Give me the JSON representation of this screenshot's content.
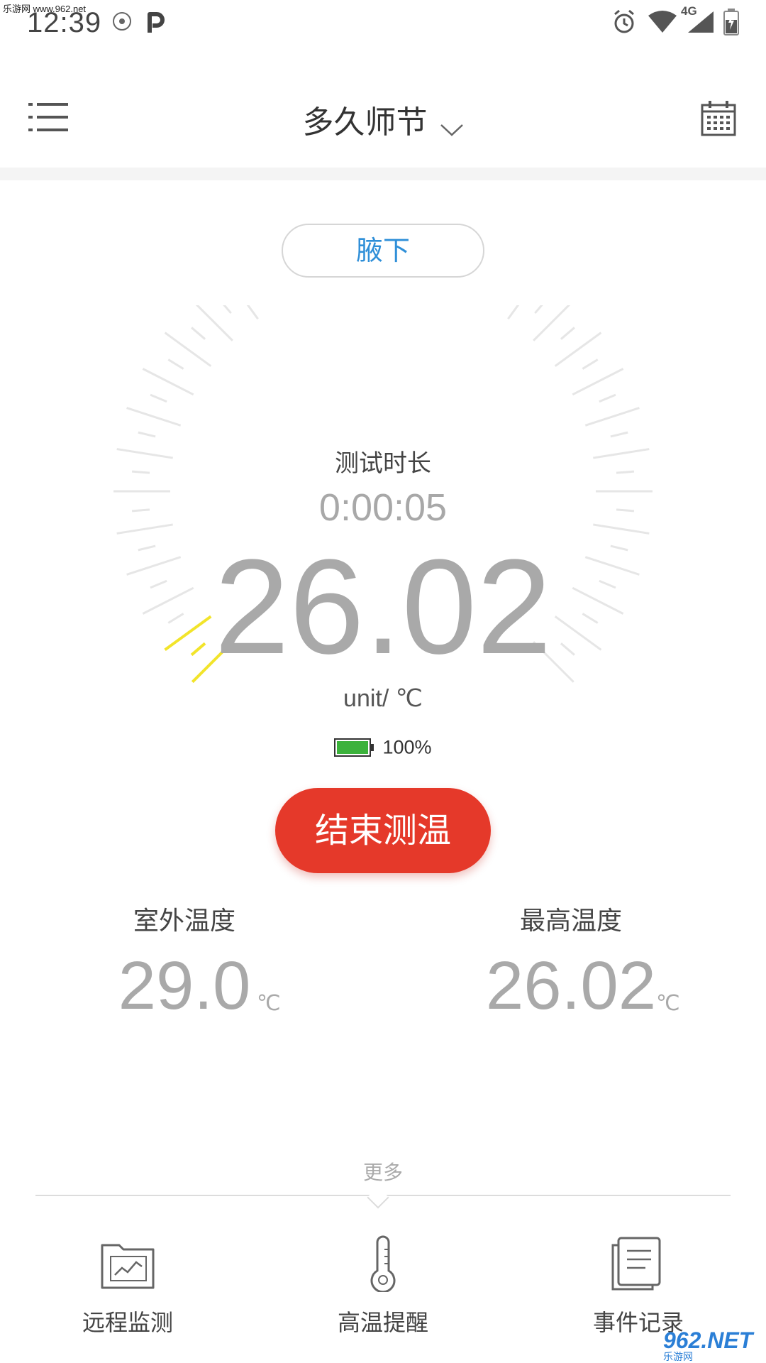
{
  "status_bar": {
    "watermark": "乐游网 www.962.net",
    "time": "12:39",
    "network": "4G"
  },
  "header": {
    "title": "多久师节",
    "menu_icon": "list-menu-icon",
    "calendar_icon": "calendar-icon"
  },
  "measure": {
    "position_label": "腋下",
    "duration_label": "测试时长",
    "duration": "0:00:05",
    "temperature": "26.02",
    "unit": "unit/ ℃",
    "battery_percent": "100%",
    "battery_level": 1.0,
    "end_button": "结束测温"
  },
  "stats": {
    "outdoor_label": "室外温度",
    "outdoor_value": "29.0",
    "outdoor_unit": "℃",
    "max_label": "最高温度",
    "max_value": "26.02",
    "max_unit": "℃"
  },
  "more": {
    "label": "更多",
    "tools": [
      {
        "label": "远程监测",
        "icon": "chart-folder-icon"
      },
      {
        "label": "高温提醒",
        "icon": "thermometer-icon"
      },
      {
        "label": "事件记录",
        "icon": "document-list-icon"
      }
    ]
  },
  "watermark_corner": {
    "brand": "962.NET",
    "sub": "乐游网"
  },
  "colors": {
    "accent_blue": "#2f8fd8",
    "end_red": "#e5392a",
    "gauge_active": "#f2e42a",
    "gauge_idle": "#e6e6e6",
    "battery_green": "#3bb23b"
  }
}
